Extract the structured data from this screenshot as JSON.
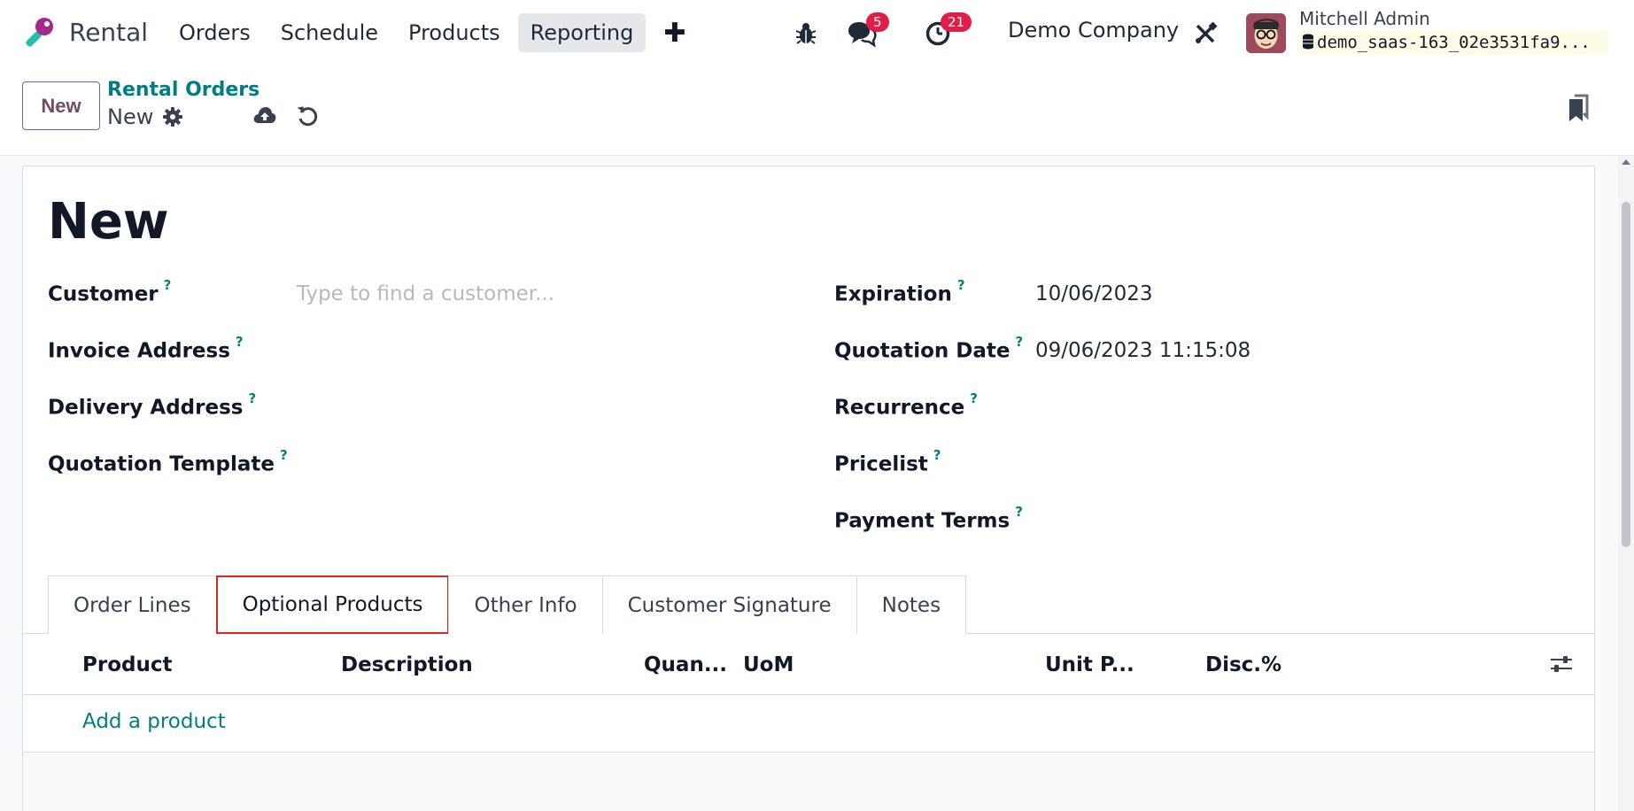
{
  "navbar": {
    "app_name": "Rental",
    "menu": [
      "Orders",
      "Schedule",
      "Products",
      "Reporting"
    ],
    "active_menu": "Reporting",
    "plus_label": "✚",
    "messages_badge": "5",
    "activities_badge": "21",
    "company": "Demo Company",
    "user_name": "Mitchell Admin",
    "db_name": "demo_saas-163_02e3531fa9..."
  },
  "control": {
    "new_label": "New",
    "breadcrumb_parent": "Rental Orders",
    "breadcrumb_current": "New"
  },
  "form": {
    "title": "New",
    "left_fields": [
      {
        "label": "Customer",
        "value": "",
        "placeholder": "Type to find a customer..."
      },
      {
        "label": "Invoice Address",
        "value": ""
      },
      {
        "label": "Delivery Address",
        "value": ""
      },
      {
        "label": "Quotation Template",
        "value": ""
      }
    ],
    "right_fields": [
      {
        "label": "Expiration",
        "value": "10/06/2023"
      },
      {
        "label": "Quotation Date",
        "value": "09/06/2023 11:15:08"
      },
      {
        "label": "Recurrence",
        "value": ""
      },
      {
        "label": "Pricelist",
        "value": ""
      },
      {
        "label": "Payment Terms",
        "value": ""
      }
    ],
    "help_mark": "?"
  },
  "tabs": [
    "Order Lines",
    "Optional Products",
    "Other Info",
    "Customer Signature",
    "Notes"
  ],
  "highlighted_tab": "Optional Products",
  "table": {
    "columns": [
      "Product",
      "Description",
      "Quan...",
      "UoM",
      "Unit P...",
      "Disc.%"
    ],
    "add_label": "Add a product"
  },
  "colors": {
    "accent": "#017e84",
    "brand": "#714b67",
    "badge": "#e11d48",
    "highlight_border": "#dc2626"
  }
}
